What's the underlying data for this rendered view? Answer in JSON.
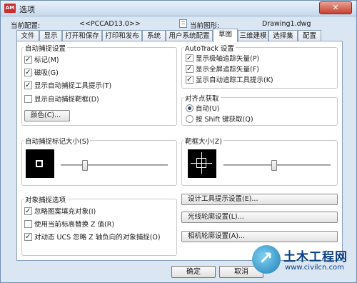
{
  "window": {
    "title": "选项",
    "logo_text": "AM",
    "close_label": "✕"
  },
  "info": {
    "profile_label": "当前配置:",
    "profile_value": "<<PCCAD13.0>>",
    "drawing_label": "当前图形:",
    "drawing_value": "Drawing1.dwg"
  },
  "tabs": [
    "文件",
    "显示",
    "打开和保存",
    "打印和发布",
    "系统",
    "用户系统配置",
    "草图",
    "三维建模",
    "选择集",
    "配置"
  ],
  "active_tab": "草图",
  "autosnap": {
    "title": "自动捕捉设置",
    "items": [
      {
        "label": "标记(M)",
        "checked": true
      },
      {
        "label": "磁吸(G)",
        "checked": true
      },
      {
        "label": "显示自动捕捉工具提示(T)",
        "checked": true
      },
      {
        "label": "显示自动捕捉靶框(D)",
        "checked": false
      }
    ],
    "color_button": "颜色(C)..."
  },
  "autotrack": {
    "title": "AutoTrack 设置",
    "items": [
      {
        "label": "显示极轴追踪矢量(P)",
        "checked": true
      },
      {
        "label": "显示全屏追踪矢量(F)",
        "checked": true
      },
      {
        "label": "显示自动追踪工具提示(K)",
        "checked": true
      }
    ]
  },
  "alignment": {
    "title": "对齐点获取",
    "options": [
      {
        "label": "自动(U)",
        "selected": true
      },
      {
        "label": "按 Shift 键获取(Q)",
        "selected": false
      }
    ]
  },
  "marker_size": {
    "title": "自动捕捉标记大小(S)"
  },
  "aperture_size": {
    "title": "靶框大小(Z)"
  },
  "osnap": {
    "title": "对象捕捉选项",
    "items": [
      {
        "label": "忽略图案填充对象(I)",
        "checked": true
      },
      {
        "label": "使用当前标高替换 Z 值(R)",
        "checked": false
      },
      {
        "label": "对动态 UCS 忽略 Z 轴负向的对象捕捉(O)",
        "checked": true
      }
    ]
  },
  "buttons": {
    "tooltip": "设计工具提示设置(E)...",
    "lightglyph": "光线轮廓设置(L)...",
    "camera": "相机轮廓设置(A)...",
    "ok": "确定",
    "cancel": "取消"
  },
  "watermark": {
    "name": "土木工程网",
    "url": "www.civilcn.com"
  }
}
